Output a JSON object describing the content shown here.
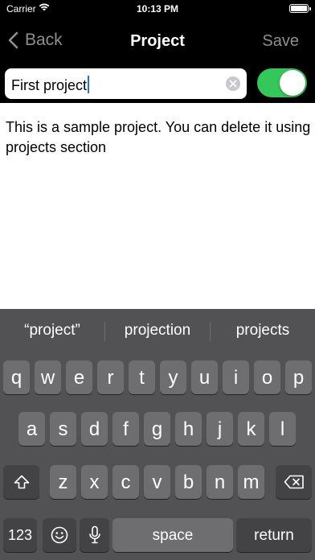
{
  "status_bar": {
    "carrier": "Carrier",
    "time": "10:13 PM"
  },
  "nav": {
    "back_label": "Back",
    "title": "Project",
    "save_label": "Save"
  },
  "project": {
    "title_value": "First project",
    "enabled": true,
    "description": "This is a sample project. You can delete it using projects section"
  },
  "keyboard": {
    "suggestions": [
      "“project”",
      "projection",
      "projects"
    ],
    "row1": [
      "q",
      "w",
      "e",
      "r",
      "t",
      "y",
      "u",
      "i",
      "o",
      "p"
    ],
    "row2": [
      "a",
      "s",
      "d",
      "f",
      "g",
      "h",
      "j",
      "k",
      "l"
    ],
    "row3": [
      "z",
      "x",
      "c",
      "v",
      "b",
      "n",
      "m"
    ],
    "numbers_label": "123",
    "space_label": "space",
    "return_label": "return"
  },
  "colors": {
    "toggle_on": "#34c759",
    "accent_inactive": "#8e8e93"
  }
}
